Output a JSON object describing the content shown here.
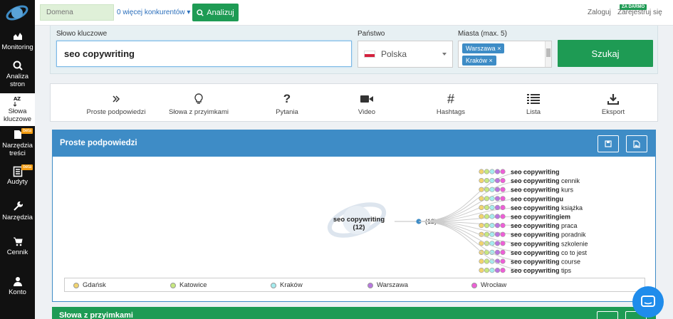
{
  "sidebar": {
    "items": [
      {
        "label": "Monitoring",
        "icon": "chart-icon"
      },
      {
        "label": "Analiza stron",
        "icon": "search-icon"
      },
      {
        "label": "Słowa kluczowe",
        "icon": "sort-az-icon",
        "active": true
      },
      {
        "label": "Narzędzia treści",
        "icon": "content-icon",
        "badge": "beta"
      },
      {
        "label": "Audyty",
        "icon": "audit-icon",
        "badge": "beta"
      },
      {
        "label": "Narzędzia",
        "icon": "wrench-icon"
      },
      {
        "label": "Cennik",
        "icon": "cart-icon"
      },
      {
        "label": "Konto",
        "icon": "user-icon"
      }
    ]
  },
  "topbar": {
    "domain_placeholder": "Domena",
    "competitors_link": "0 więcej konkurentów",
    "analyze_label": "Analizuj",
    "login_label": "Zaloguj",
    "register_label": "Zarejestruj się",
    "free_badge": "ZA DARMO"
  },
  "search": {
    "keyword_label": "Słowo kluczowe",
    "keyword_value": "seo copywriting",
    "country_label": "Państwo",
    "country_value": "Polska",
    "cities_label": "Miasta (max. 5)",
    "cities": [
      "Warszawa",
      "Kraków"
    ],
    "search_button": "Szukaj"
  },
  "tabs": [
    {
      "label": "Proste podpowiedzi",
      "icon": "double-chevron-icon"
    },
    {
      "label": "Słowa z przyimkami",
      "icon": "lightbulb-icon"
    },
    {
      "label": "Pytania",
      "icon": "question-icon"
    },
    {
      "label": "Video",
      "icon": "video-icon"
    },
    {
      "label": "Hashtags",
      "icon": "hashtag-icon"
    },
    {
      "label": "Lista",
      "icon": "list-icon"
    },
    {
      "label": "Eksport",
      "icon": "download-icon"
    }
  ],
  "panel": {
    "title": "Proste podpowiedzi",
    "root_label": "seo copywriting",
    "root_count": "(12)",
    "node_count": "(12)",
    "suggestions": [
      {
        "bold": "seo copywriting",
        "rest": ""
      },
      {
        "bold": "seo copywriting",
        "rest": " cennik"
      },
      {
        "bold": "seo copywriting",
        "rest": " kurs"
      },
      {
        "bold": "seo copywritingu",
        "rest": ""
      },
      {
        "bold": "seo copywriting",
        "rest": " książka"
      },
      {
        "bold": "seo copywritingiem",
        "rest": ""
      },
      {
        "bold": "seo copywriting",
        "rest": " praca"
      },
      {
        "bold": "seo copywriting",
        "rest": " poradnik"
      },
      {
        "bold": "seo copywriting",
        "rest": " szkolenie"
      },
      {
        "bold": "seo copywriting",
        "rest": " co to jest"
      },
      {
        "bold": "seo copywriting",
        "rest": " course"
      },
      {
        "bold": "seo copywriting",
        "rest": " tips"
      }
    ],
    "legend": [
      {
        "label": "Gdańsk",
        "color": "#f1d46f"
      },
      {
        "label": "Katowice",
        "color": "#c7e87f"
      },
      {
        "label": "Kraków",
        "color": "#a5ecef"
      },
      {
        "label": "Warszawa",
        "color": "#b877e0"
      },
      {
        "label": "Wrocław",
        "color": "#ee5fd7"
      }
    ]
  },
  "panel2": {
    "title": "Słowa z przyimkami"
  }
}
